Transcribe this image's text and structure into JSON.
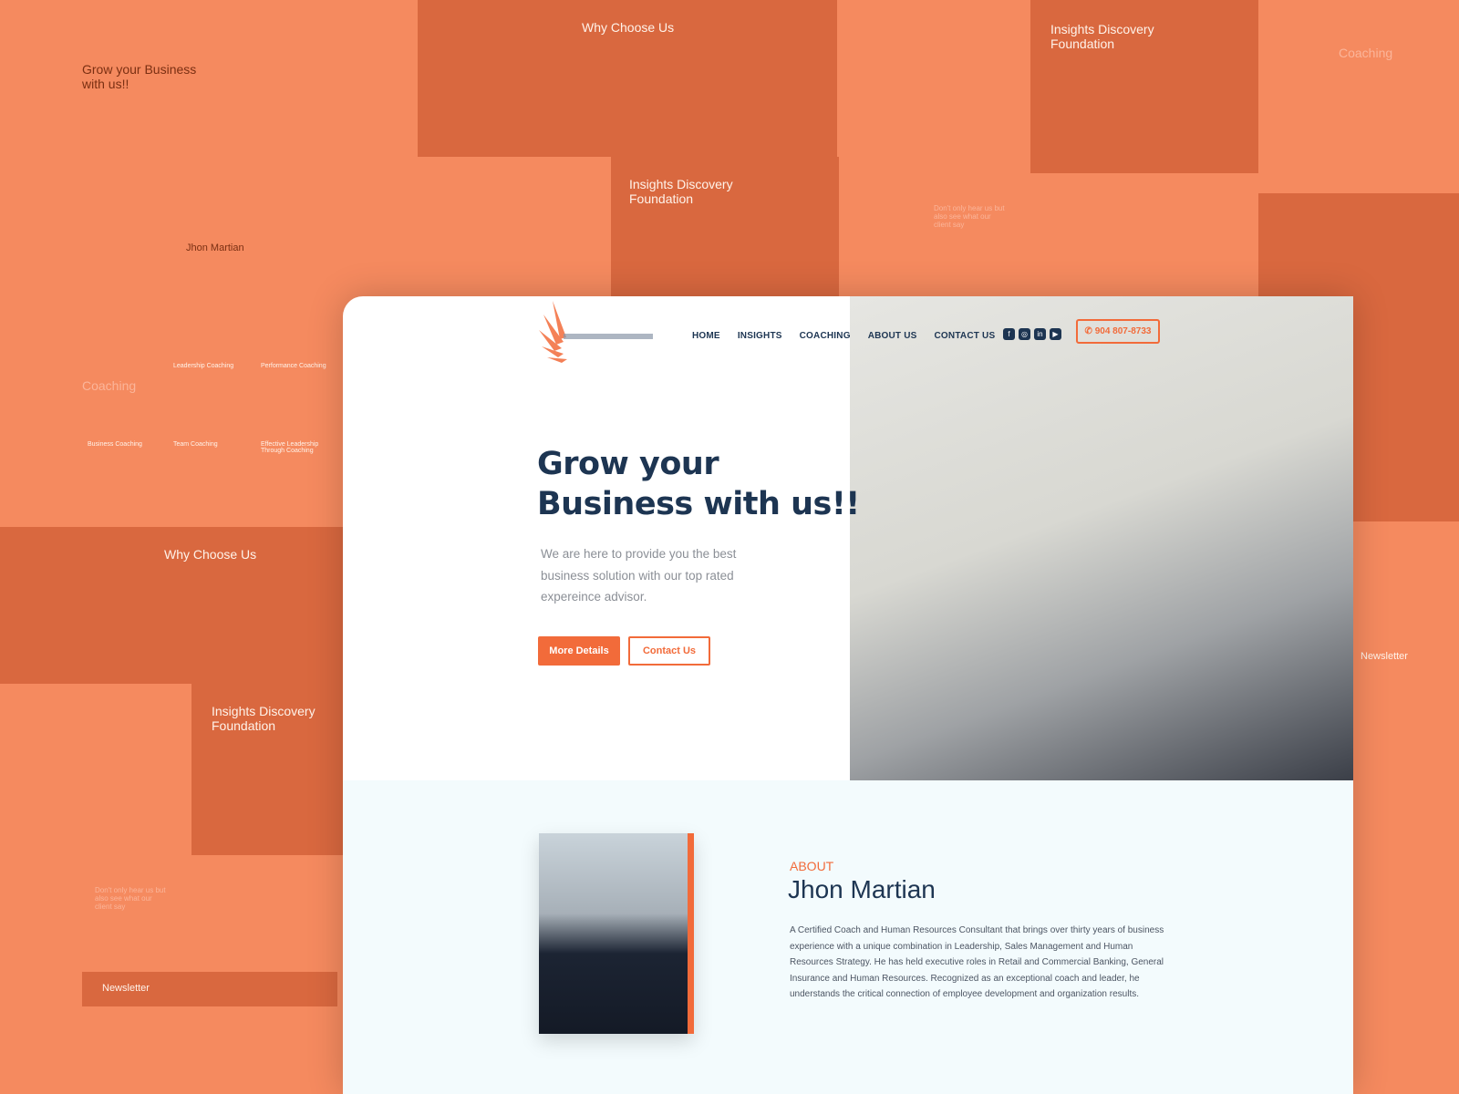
{
  "background": {
    "why_choose": "Why Choose Us",
    "insights": "Insights Discovery Foundation",
    "coaching": "Coaching",
    "grow": "Grow your Business with us!!",
    "name": "Jhon Martian",
    "newsletter": "Newsletter",
    "leadership": "Leadership Coaching",
    "performance": "Performance Coaching",
    "business": "Business Coaching",
    "team": "Team Coaching",
    "effective": "Effective Leadership Through Coaching",
    "testimonial": "Don't only hear us but also see what our client say"
  },
  "header": {
    "nav": [
      "HOME",
      "INSIGHTS",
      "COACHING",
      "ABOUT US",
      "CONTACT US"
    ],
    "social": [
      "facebook-icon",
      "instagram-icon",
      "linkedin-icon",
      "youtube-icon"
    ],
    "phone": "904 807-8733"
  },
  "hero": {
    "title_1": "Grow your",
    "title_2": "Business with us!!",
    "text": "We are here to provide you the best business solution with our top rated expereince advisor.",
    "more": "More Details",
    "contact": "Contact Us"
  },
  "about": {
    "label": "ABOUT",
    "name": "Jhon Martian",
    "text": "A Certified Coach and Human Resources Consultant that brings over thirty years of business experience with a unique combination in Leadership, Sales Management and Human Resources Strategy.  He has held executive roles in Retail and Commercial Banking, General Insurance and Human Resources. Recognized as an exceptional coach and leader, he understands the critical connection of employee development and organization results."
  },
  "colors": {
    "accent": "#f26b3a",
    "navy": "#1d3552",
    "bg": "#f58a5f"
  }
}
